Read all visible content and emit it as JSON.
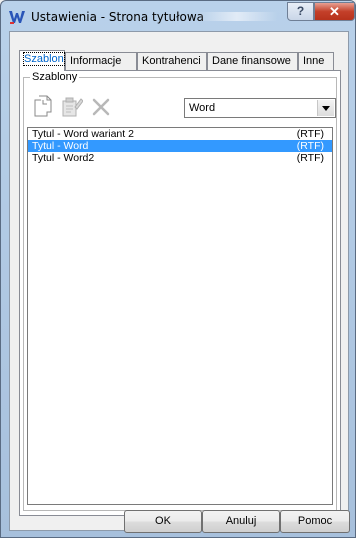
{
  "window": {
    "title": "Ustawienia - Strona tytułowa",
    "help_label": "?",
    "close_label": "✕"
  },
  "tabs": [
    {
      "label": "Szablon",
      "active": true
    },
    {
      "label": "Informacje",
      "active": false
    },
    {
      "label": "Kontrahenci",
      "active": false
    },
    {
      "label": "Dane finansowe",
      "active": false
    },
    {
      "label": "Inne",
      "active": false
    }
  ],
  "group": {
    "label": "Szablony",
    "toolbar": [
      {
        "icon": "new-document-icon",
        "enabled": true
      },
      {
        "icon": "edit-document-icon",
        "enabled": false
      },
      {
        "icon": "delete-icon",
        "enabled": false
      }
    ],
    "format_select": {
      "value": "Word"
    }
  },
  "list": [
    {
      "name": "Tytul - Word wariant 2",
      "type": "(RTF)",
      "selected": false
    },
    {
      "name": "Tytul - Word",
      "type": "(RTF)",
      "selected": true
    },
    {
      "name": "Tytul - Word2",
      "type": "(RTF)",
      "selected": false
    }
  ],
  "buttons": {
    "ok": "OK",
    "cancel": "Anuluj",
    "help": "Pomoc"
  },
  "colors": {
    "selection": "#3399ff",
    "active_tab_text": "#0066cc",
    "close_button": "#c4402a"
  }
}
